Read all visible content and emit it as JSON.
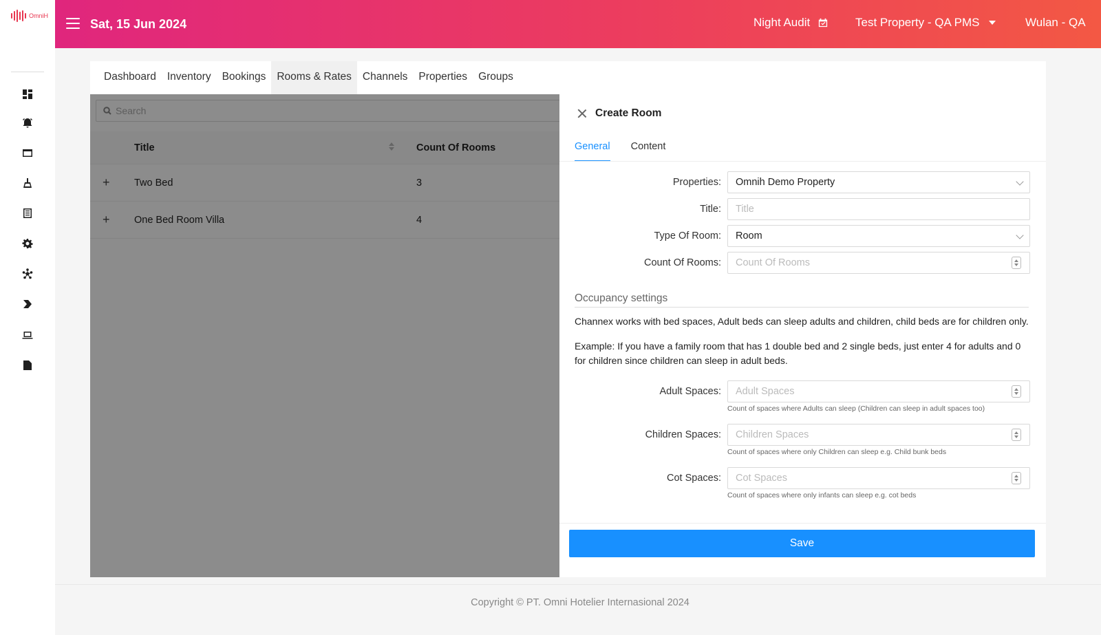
{
  "app": {
    "logo_text": "OmniH",
    "brand_color": "#e8354f"
  },
  "header": {
    "date": "Sat, 15 Jun 2024",
    "night_audit": "Night Audit",
    "property": "Test Property - QA PMS",
    "user": "Wulan - QA",
    "gradient": [
      "#e0267d",
      "#f35844"
    ]
  },
  "sidebar": {
    "icons": [
      "dashboard-icon",
      "alarm-icon",
      "calendar-icon",
      "housekeeping-icon",
      "report-icon",
      "settings-icon",
      "integration-icon",
      "channel-icon",
      "laptop-icon",
      "document-icon"
    ]
  },
  "nav": {
    "tabs": [
      "Dashboard",
      "Inventory",
      "Bookings",
      "Rooms & Rates",
      "Channels",
      "Properties",
      "Groups"
    ],
    "active": "Rooms & Rates"
  },
  "search": {
    "placeholder": "Search"
  },
  "table": {
    "columns": [
      "Title",
      "Count Of Rooms"
    ],
    "rows": [
      {
        "title": "Two Bed",
        "count": "3"
      },
      {
        "title": "One Bed Room Villa",
        "count": "4"
      }
    ]
  },
  "drawer": {
    "title": "Create Room",
    "tabs": [
      "General",
      "Content"
    ],
    "active_tab": "General",
    "fields": {
      "properties": {
        "label": "Properties:",
        "value": "Omnih Demo Property"
      },
      "title": {
        "label": "Title:",
        "placeholder": "Title"
      },
      "type_of_room": {
        "label": "Type Of Room:",
        "value": "Room"
      },
      "count_of_rooms": {
        "label": "Count Of Rooms:",
        "placeholder": "Count Of Rooms"
      }
    },
    "occupancy": {
      "title": "Occupancy settings",
      "desc1": "Channex works with bed spaces, Adult beds can sleep adults and children, child beds are for children only.",
      "desc2": "Example: If you have a family room that has 1 double bed and 2 single beds, just enter 4 for adults and 0 for children since children can sleep in adult beds.",
      "adult": {
        "label": "Adult Spaces:",
        "placeholder": "Adult Spaces",
        "help": "Count of spaces where Adults can sleep (Children can sleep in adult spaces too)"
      },
      "children": {
        "label": "Children Spaces:",
        "placeholder": "Children Spaces",
        "help": "Count of spaces where only Children can sleep e.g. Child bunk beds"
      },
      "cot": {
        "label": "Cot Spaces:",
        "placeholder": "Cot Spaces",
        "help": "Count of spaces where only infants can sleep e.g. cot beds"
      }
    },
    "save_label": "Save",
    "accent": "#1890ff"
  },
  "footer": {
    "copyright": "Copyright © PT. Omni Hotelier Internasional 2024"
  }
}
